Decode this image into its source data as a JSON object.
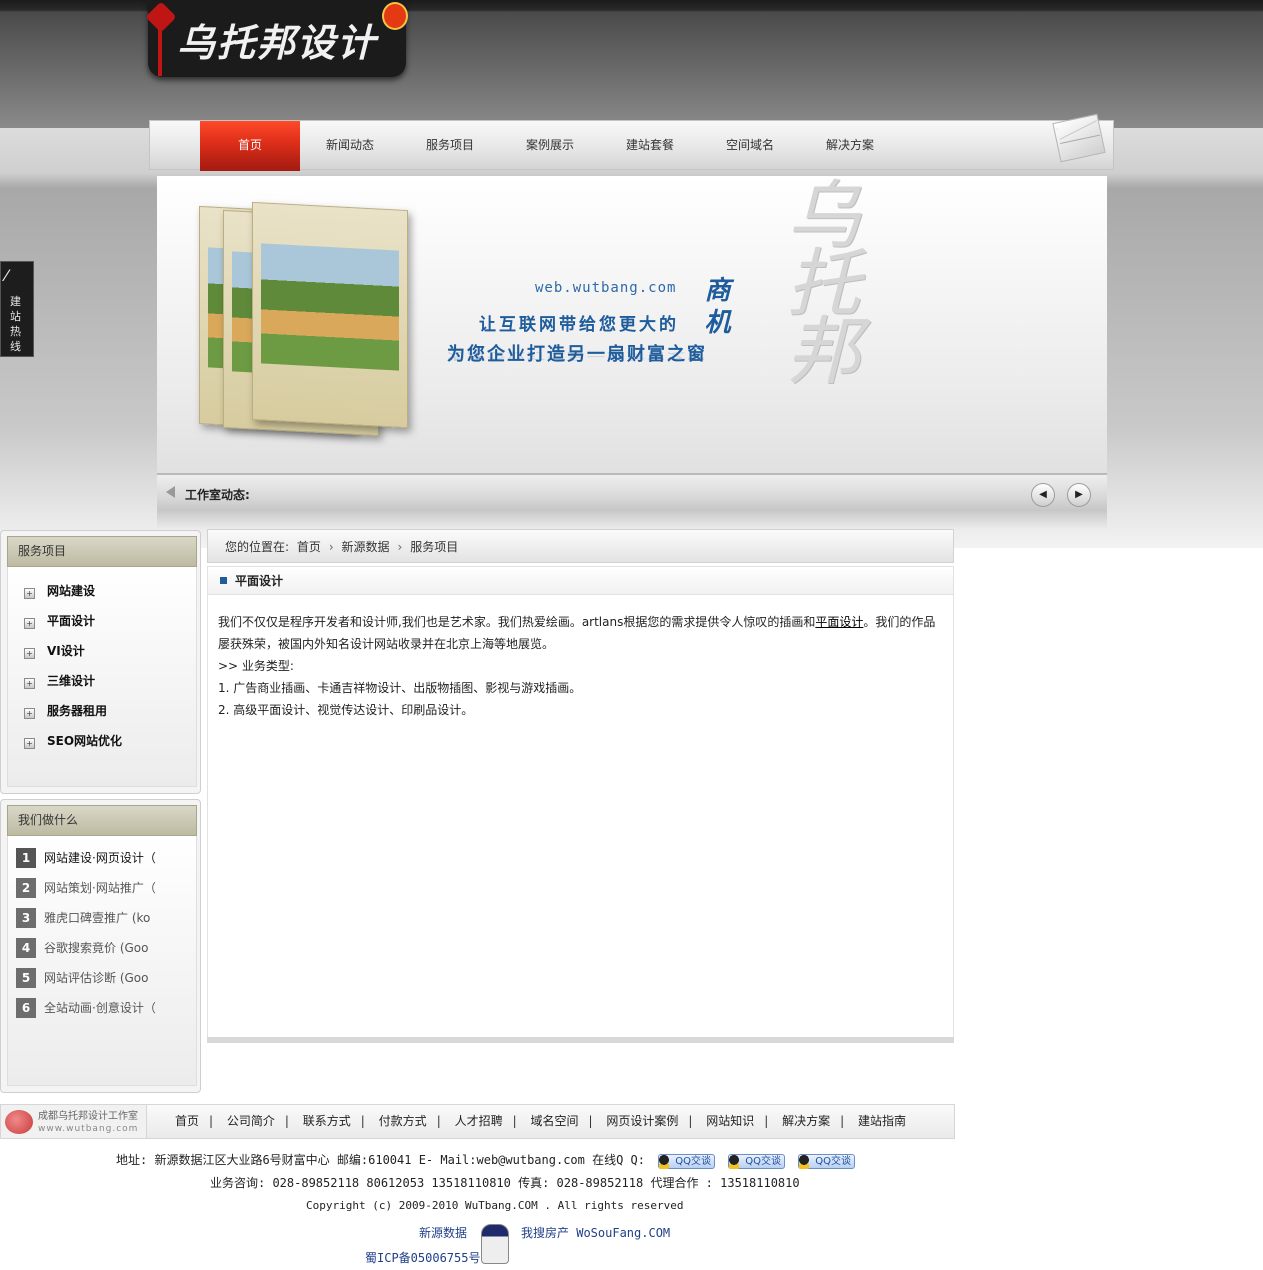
{
  "header": {
    "logo_text": "乌托邦设计"
  },
  "nav": {
    "items": [
      {
        "label": "首页",
        "active": true
      },
      {
        "label": "新闻动态"
      },
      {
        "label": "服务项目"
      },
      {
        "label": "案例展示"
      },
      {
        "label": "建站套餐"
      },
      {
        "label": "空间域名"
      },
      {
        "label": "解决方案"
      }
    ],
    "mail_icon": "envelope-icon"
  },
  "banner": {
    "url": "web.wutbang.com",
    "line1": "让互联网带给您更大的",
    "line2": "为您企业打造另一扇财富之窗",
    "opportunity": "商机",
    "calligraphy": "乌托邦"
  },
  "newsbar": {
    "label": "工作室动态:",
    "prev_icon": "prev-arrow-icon",
    "next_icon": "next-arrow-icon"
  },
  "hotline": {
    "label": "建站热线",
    "icon": "magic-wand-icon"
  },
  "sidebar": {
    "services": {
      "title": "服务项目",
      "items": [
        "网站建设",
        "平面设计",
        "VI设计",
        "三维设计",
        "服务器租用",
        "SEO网站优化"
      ]
    },
    "what_we_do": {
      "title": "我们做什么",
      "items": [
        {
          "num": "1",
          "text": "网站建设·网页设计（"
        },
        {
          "num": "2",
          "text": "网站策划·网站推广（"
        },
        {
          "num": "3",
          "text": "雅虎口碑壹推广 (ko"
        },
        {
          "num": "4",
          "text": "谷歌搜索竟价 (Goo"
        },
        {
          "num": "5",
          "text": "网站评估诊断 (Goo"
        },
        {
          "num": "6",
          "text": "全站动画·创意设计（"
        }
      ]
    }
  },
  "breadcrumb": {
    "prefix": "您的位置在:",
    "items": [
      "首页",
      "新源数据",
      "服务项目"
    ]
  },
  "content": {
    "title": "平面设计",
    "para1_a": "我们不仅仅是程序开发者和设计师,我们也是艺术家。我们热爱绘画。artlans根据您的需求提供令人惊叹的插画和",
    "para1_link": "平面设计",
    "para1_b": "。我们的作品屡获殊荣，被国内外知名设计网站收录并在北京上海等地展览。",
    "line2": ">> 业务类型:",
    "line3": "1. 广告商业插画、卡通吉祥物设计、出版物插图、影视与游戏插画。",
    "line4": "2. 高级平面设计、视觉传达设计、印刷品设计。"
  },
  "footer": {
    "logo_text": "成都乌托邦设计工作室",
    "logo_url": "www.wutbang.com",
    "links": [
      "首页",
      "公司简介",
      "联系方式",
      "付款方式",
      "人才招聘",
      "域名空间",
      "网页设计案例",
      "网站知识",
      "解决方案",
      "建站指南"
    ],
    "address": "地址: 新源数据江区大业路6号财富中心   邮编:610041   E- Mail:web@wutbang.com   在线Q Q:",
    "qq_label": "QQ交谈",
    "business": "业务咨询: 028-89852118 80612053  13518110810  传真: 028-89852118   代理合作 : 13518110810",
    "copyright": "Copyright (c) 2009-2010 WuTbang.COM . All rights reserved",
    "partner1": "新源数据",
    "partner2": "我搜房产 WoSouFang.COM",
    "icp": "蜀ICP备05006755号"
  }
}
